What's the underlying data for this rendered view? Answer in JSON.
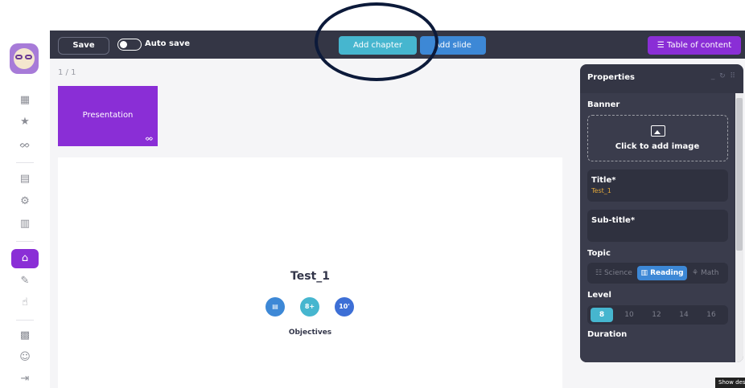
{
  "toolbar": {
    "save_label": "Save",
    "autosave_label": "Auto save",
    "add_chapter_label": "Add chapter",
    "add_slide_label": "Add slide",
    "toc_label": "☰ Table of content"
  },
  "workspace": {
    "page_counter": "1 / 1",
    "thumbnail_label": "Presentation"
  },
  "slide": {
    "title": "Test_1",
    "chip_topic": "▤",
    "chip_age": "8+",
    "chip_duration": "10'",
    "objectives": "Objectives"
  },
  "properties": {
    "title": "Properties",
    "banner_label": "Banner",
    "upload_text": "Click to add image",
    "title_field_label": "Title*",
    "title_field_value": "Test_1",
    "subtitle_field_label": "Sub-title*",
    "topic_label": "Topic",
    "topics": [
      "Science",
      "Reading",
      "Math"
    ],
    "selected_topic": "Reading",
    "level_label": "Level",
    "levels": [
      "8",
      "10",
      "12",
      "14",
      "16"
    ],
    "selected_level": "8",
    "duration_label": "Duration"
  },
  "tooltip": "Show des",
  "colors": {
    "topbar": "#343645",
    "primary_purple": "#8a2ed6",
    "chapter_teal": "#46b6cf",
    "slide_blue": "#3d88d6",
    "field_value_orange": "#e3a83a"
  },
  "icons": {
    "sidebar": [
      "grid-icon",
      "star-icon",
      "binoculars-icon",
      "document-icon",
      "settings-icon",
      "book-icon",
      "graduation-cap-icon",
      "edit-icon",
      "hand-icon",
      "flag-icon",
      "users-settings-icon",
      "logout-icon"
    ]
  }
}
